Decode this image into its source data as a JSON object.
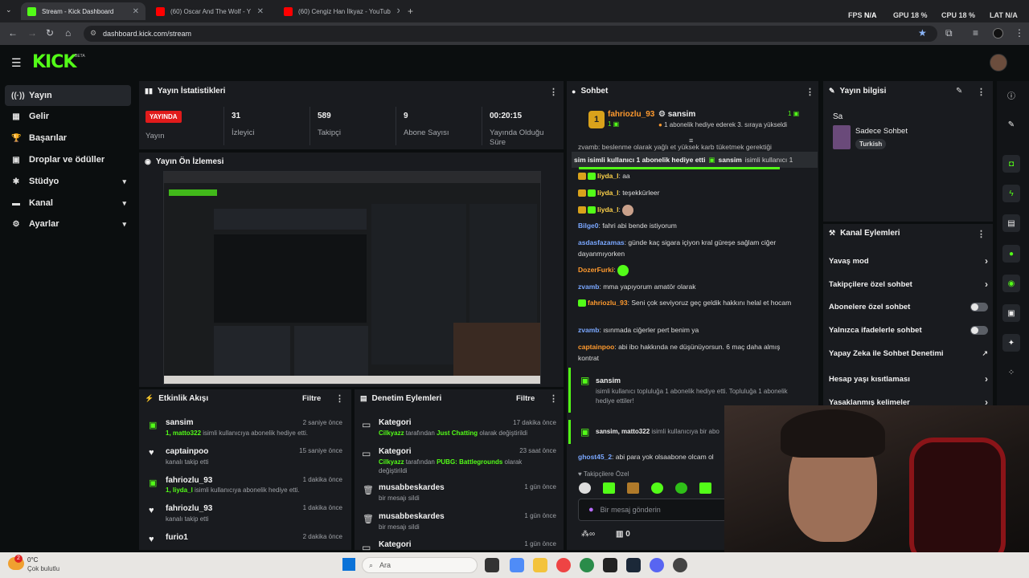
{
  "browser": {
    "tabs": [
      {
        "title": "Stream - Kick Dashboard",
        "active": true
      },
      {
        "title": "(60) Oscar And The Wolf - Y"
      },
      {
        "title": "(60) Cengiz Han İlkyaz - YouTub"
      }
    ],
    "url": "dashboard.kick.com/stream",
    "perf": {
      "fps_label": "FPS",
      "fps_value": "N/A",
      "gpu_label": "GPU",
      "gpu_value": "18 %",
      "cpu_label": "CPU",
      "cpu_value": "18 %",
      "lat_label": "LAT",
      "lat_value": "N/A"
    }
  },
  "app": {
    "logo": "KICK",
    "beta": "BETA"
  },
  "sidebar": {
    "items": [
      {
        "label": "Yayın",
        "icon": "broadcast-icon"
      },
      {
        "label": "Gelir",
        "icon": "revenue-icon"
      },
      {
        "label": "Başarılar",
        "icon": "trophy-icon"
      },
      {
        "label": "Droplar ve ödüller",
        "icon": "gift-icon"
      },
      {
        "label": "Stüdyo",
        "icon": "studio-icon"
      },
      {
        "label": "Kanal",
        "icon": "channel-icon"
      },
      {
        "label": "Ayarlar",
        "icon": "settings-icon"
      }
    ]
  },
  "stats": {
    "title": "Yayın İstatistikleri",
    "live_badge": "YAYINDA",
    "live_label": "Yayın",
    "viewers": "31",
    "viewers_label": "İzleyici",
    "followers": "589",
    "followers_label": "Takipçi",
    "subs": "9",
    "subs_label": "Abone Sayısı",
    "uptime": "00:20:15",
    "uptime_label": "Yayında Olduğu Süre"
  },
  "preview": {
    "title": "Yayın Ön İzlemesi"
  },
  "activity": {
    "title": "Etkinlik Akışı",
    "filter": "Filtre",
    "items": [
      {
        "name": "sansim",
        "time": "2 saniye önce",
        "pre": "1, matto322",
        "sub": " isimli kullanıcıya abonelik hediye etti."
      },
      {
        "name": "captainpoo",
        "time": "15 saniye önce",
        "pre": "",
        "sub": "kanalı takip etti"
      },
      {
        "name": "fahriozlu_93",
        "time": "1 dakika önce",
        "pre": "1, liyda_l",
        "sub": " isimli kullanıcıya abonelik hediye etti."
      },
      {
        "name": "fahriozlu_93",
        "time": "1 dakika önce",
        "pre": "",
        "sub": "kanalı takip etti"
      },
      {
        "name": "furio1",
        "time": "2 dakika önce",
        "pre": "",
        "sub": ""
      }
    ]
  },
  "moderation": {
    "title": "Denetim Eylemleri",
    "filter": "Filtre",
    "items": [
      {
        "name": "Kategori",
        "time": "17 dakika önce",
        "actor": "Cilkyazz",
        "mid": " tarafından ",
        "value": "Just Chatting",
        "tail": " olarak değiştirildi"
      },
      {
        "name": "Kategori",
        "time": "23 saat önce",
        "actor": "Cilkyazz",
        "mid": " tarafından ",
        "value": "PUBG: Battlegrounds",
        "tail": " olarak değiştirildi"
      },
      {
        "name": "musabbeskardes",
        "time": "1 gün önce",
        "sub": "bir mesajı sildi"
      },
      {
        "name": "musabbeskardes",
        "time": "1 gün önce",
        "sub": "bir mesajı sildi"
      },
      {
        "name": "Kategori",
        "time": "1 gün önce",
        "sub": ""
      }
    ]
  },
  "chat": {
    "title": "Sohbet",
    "leader1": {
      "name": "fahriozlu_93",
      "count": "1"
    },
    "leader2": {
      "name": "sansim",
      "count": "1",
      "note": "1 abonelik hediye ederek 3. sıraya yükseldi"
    },
    "ticker_top": "zvamb: beslenme olarak yağlı et yüksek karb tüketmek gerektiği",
    "ticker": "sim isimli kullanıcı 1 abonelik hediye etti",
    "ticker2": "sansim",
    "ticker3": " isimli kullanıcı 1",
    "messages": [
      {
        "user": "liyda_l",
        "cls": "u-yellow",
        "text": ": aa"
      },
      {
        "user": "liyda_l",
        "cls": "u-yellow",
        "text": ": teşekkürleer"
      },
      {
        "user": "liyda_l",
        "cls": "u-yellow",
        "text": ":"
      },
      {
        "user": "Bilge0",
        "cls": "u-blue",
        "text": ": fahri abi bende istiyorum"
      },
      {
        "user": "asdasfazamas",
        "cls": "u-blue",
        "text": ": günde kaç sigara içiyon kral güreşe sağlam ciğer dayanmıyorken"
      },
      {
        "user": "DozerFurki",
        "cls": "u-orange",
        "text": ":"
      },
      {
        "user": "zvamb",
        "cls": "u-blue",
        "text": ": mma yapıyorum amatör olarak"
      },
      {
        "user": "fahriozlu_93",
        "cls": "u-orange",
        "text": ": Seni çok seviyoruz geç geldik hakkını helal et hocam"
      },
      {
        "user": "zvamb",
        "cls": "u-blue",
        "text": ": ısınmada ciğerler pert benim ya"
      },
      {
        "user": "captainpoo",
        "cls": "u-orange",
        "text": ": abi ibo hakkında ne düşünüyorsun. 6 maç daha almış kontrat"
      }
    ],
    "gift_box": {
      "user": "sansim",
      "text": "isimli kullanıcı topluluğa 1 abonelik hediye etti. Topluluğa 1 abonelik hediye ettiler!"
    },
    "gift_line": {
      "user": "sansim, matto322",
      "text": " isimli kullanıcıya bir abo"
    },
    "last": {
      "user": "ghost45_2",
      "text": ": abi para yok olsaabone olcam ol"
    },
    "followers_only": "Takipçilere Özel",
    "input_placeholder": "Bir mesaj gönderin",
    "footer_count": "0"
  },
  "info": {
    "title": "Yayın bilgisi",
    "stream_title": "Sa",
    "category": "Sadece Sohbet",
    "tag": "Turkish"
  },
  "actions": {
    "title": "Kanal Eylemleri",
    "items": [
      {
        "label": "Yavaş mod",
        "kind": "arrow"
      },
      {
        "label": "Takipçilere özel sohbet",
        "kind": "arrow"
      },
      {
        "label": "Abonelere özel sohbet",
        "kind": "toggle"
      },
      {
        "label": "Yalnızca ifadelerle sohbet",
        "kind": "toggle"
      },
      {
        "label": "Yapay Zeka ile Sohbet Denetimi",
        "kind": "ext"
      },
      {
        "label": "Hesap yaşı kısıtlaması",
        "kind": "arrow"
      },
      {
        "label": "Yasaklanmış kelimeler",
        "kind": "arrow"
      }
    ]
  },
  "weather": {
    "temp": "0°C",
    "desc": "Çok bulutlu"
  },
  "taskbar": {
    "search": "Ara",
    "badge": "2"
  },
  "colors": {
    "accent": "#53fc18",
    "live": "#e11b1b",
    "panel": "#191b1f",
    "bg": "#0b0e0f"
  }
}
